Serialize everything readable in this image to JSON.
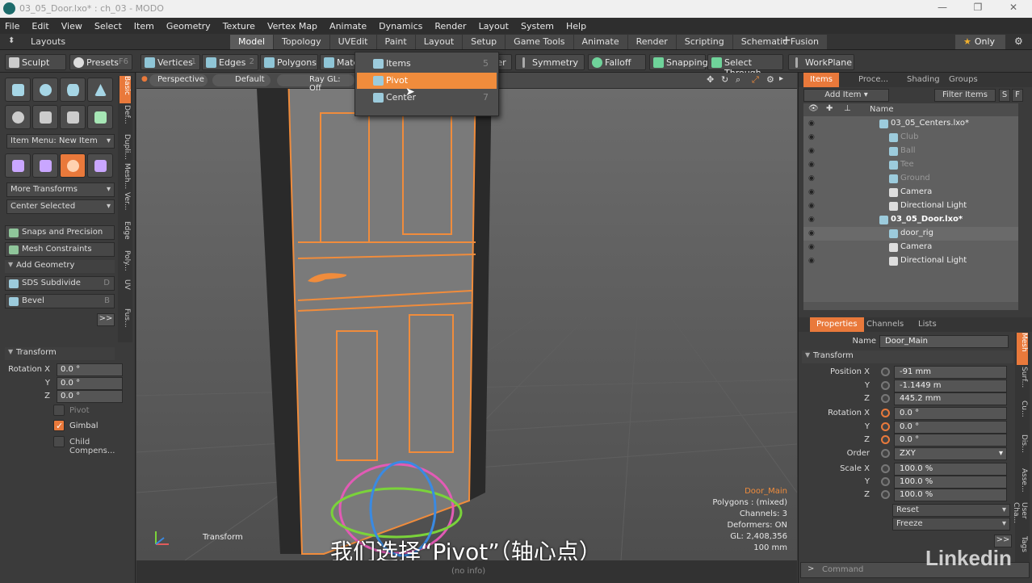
{
  "window": {
    "title": "03_05_Door.lxo* : ch_03 - MODO",
    "minimize": "—",
    "restore": "❐",
    "close": "✕"
  },
  "menu": [
    "File",
    "Edit",
    "View",
    "Select",
    "Item",
    "Geometry",
    "Texture",
    "Vertex Map",
    "Animate",
    "Dynamics",
    "Render",
    "Layout",
    "System",
    "Help"
  ],
  "layouts": {
    "label": "Layouts",
    "tabs": [
      "Model",
      "Topology",
      "UVEdit",
      "Paint",
      "Layout",
      "Setup",
      "Game Tools",
      "Animate",
      "Render",
      "Scripting",
      "Schematic Fusion"
    ],
    "active_tab": "Model",
    "add": "+",
    "only_label": "Only",
    "star": "★",
    "gear": "⚙"
  },
  "toolstrip": {
    "sculpt": "Sculpt",
    "presets": "Presets",
    "presets_key": "F6",
    "vertices": "Vertices",
    "vertices_key": "1",
    "edges": "Edges",
    "edges_key": "2",
    "polygons": "Polygons",
    "materials": "Mate",
    "symmetry": "Symmetry",
    "falloff": "Falloff",
    "snapping": "Snapping",
    "select_through": "Select Through",
    "workplane": "WorkPlane",
    "filter_partial": "ter"
  },
  "left": {
    "item_menu": "Item Menu: New Item",
    "more_transforms": "More Transforms",
    "center_selected": "Center Selected",
    "snaps_precision": "Snaps and Precision",
    "mesh_constraints": "Mesh Constraints",
    "add_geometry": "Add Geometry",
    "sds_subdivide": "SDS Subdivide",
    "sds_key": "D",
    "bevel": "Bevel",
    "bevel_key": "B",
    "more": ">>",
    "vtabs": [
      "Basic",
      "Def...",
      "Dupli...",
      "Mesh...",
      "Ver...",
      "Edge",
      "Poly...",
      "UV",
      "Fus..."
    ],
    "transform_header": "Transform",
    "rotation_x_label": "Rotation X",
    "y_label": "Y",
    "z_label": "Z",
    "rot_x": "0.0 °",
    "rot_y": "0.0 °",
    "rot_z": "0.0 °",
    "pivot_label": "Pivot",
    "gimbal_label": "Gimbal",
    "child_comp_label": "Child Compens...",
    "check_mark": "✓"
  },
  "viewport": {
    "perspective": "Perspective",
    "default": "Default",
    "raygl": "Ray GL: Off",
    "item_name": "Door_Main",
    "polygons": "Polygons : (mixed)",
    "channels": "Channels: 3",
    "deformers": "Deformers: ON",
    "gl": "GL: 2,408,356",
    "scale": "100 mm",
    "mode_label": "Transform",
    "subtitle": "我们选择“Pivot”（轴心点）"
  },
  "popup": {
    "items": [
      {
        "label": "Items",
        "key": "5"
      },
      {
        "label": "Pivot",
        "key": ""
      },
      {
        "label": "Center",
        "key": "7"
      }
    ],
    "selected": "Pivot"
  },
  "right": {
    "tabs": [
      "Items",
      "Proce...",
      "Shading",
      "Groups"
    ],
    "add_item": "Add Item",
    "filter_items": "Filter Items",
    "s_btn": "S",
    "f_btn": "F",
    "name_col": "Name",
    "tree": [
      {
        "label": "03_05_Centers.lxo*",
        "indent": 0,
        "dim": false,
        "bold": false
      },
      {
        "label": "Club",
        "indent": 1,
        "dim": true,
        "bold": false
      },
      {
        "label": "Ball",
        "indent": 1,
        "dim": true,
        "bold": false
      },
      {
        "label": "Tee",
        "indent": 1,
        "dim": true,
        "bold": false
      },
      {
        "label": "Ground",
        "indent": 1,
        "dim": true,
        "bold": false
      },
      {
        "label": "Camera",
        "indent": 1,
        "dim": false,
        "bold": false
      },
      {
        "label": "Directional Light",
        "indent": 1,
        "dim": false,
        "bold": false
      },
      {
        "label": "03_05_Door.lxo*",
        "indent": 0,
        "dim": false,
        "bold": true
      },
      {
        "label": "door_rig",
        "indent": 1,
        "dim": false,
        "bold": false
      },
      {
        "label": "Camera",
        "indent": 1,
        "dim": false,
        "bold": false
      },
      {
        "label": "Directional Light",
        "indent": 1,
        "dim": false,
        "bold": false
      }
    ],
    "prop_tabs": [
      "Properties",
      "Channels",
      "Lists"
    ],
    "name_label": "Name",
    "name_value": "Door_Main",
    "transform_header": "Transform",
    "position_x_label": "Position X",
    "rotation_x_label": "Rotation X",
    "scale_x_label": "Scale X",
    "order_label": "Order",
    "y_label": "Y",
    "z_label": "Z",
    "pos_x": "-91 mm",
    "pos_y": "-1.1449 m",
    "pos_z": "445.2 mm",
    "rot_x": "0.0 °",
    "rot_y": "0.0 °",
    "rot_z": "0.0 °",
    "order": "ZXY",
    "scale_x": "100.0 %",
    "scale_y": "100.0 %",
    "scale_z": "100.0 %",
    "reset": "Reset",
    "freeze": "Freeze",
    "more": ">>",
    "vtabs": [
      "Mesh",
      "Surf...",
      "Cu...",
      "Dis...",
      "Asse...",
      "User Cha...",
      "Tags"
    ],
    "command_placeholder": "Command",
    "prompt": ">"
  },
  "statusbar": {
    "info": "(no info)"
  },
  "watermark": "Linkedin"
}
